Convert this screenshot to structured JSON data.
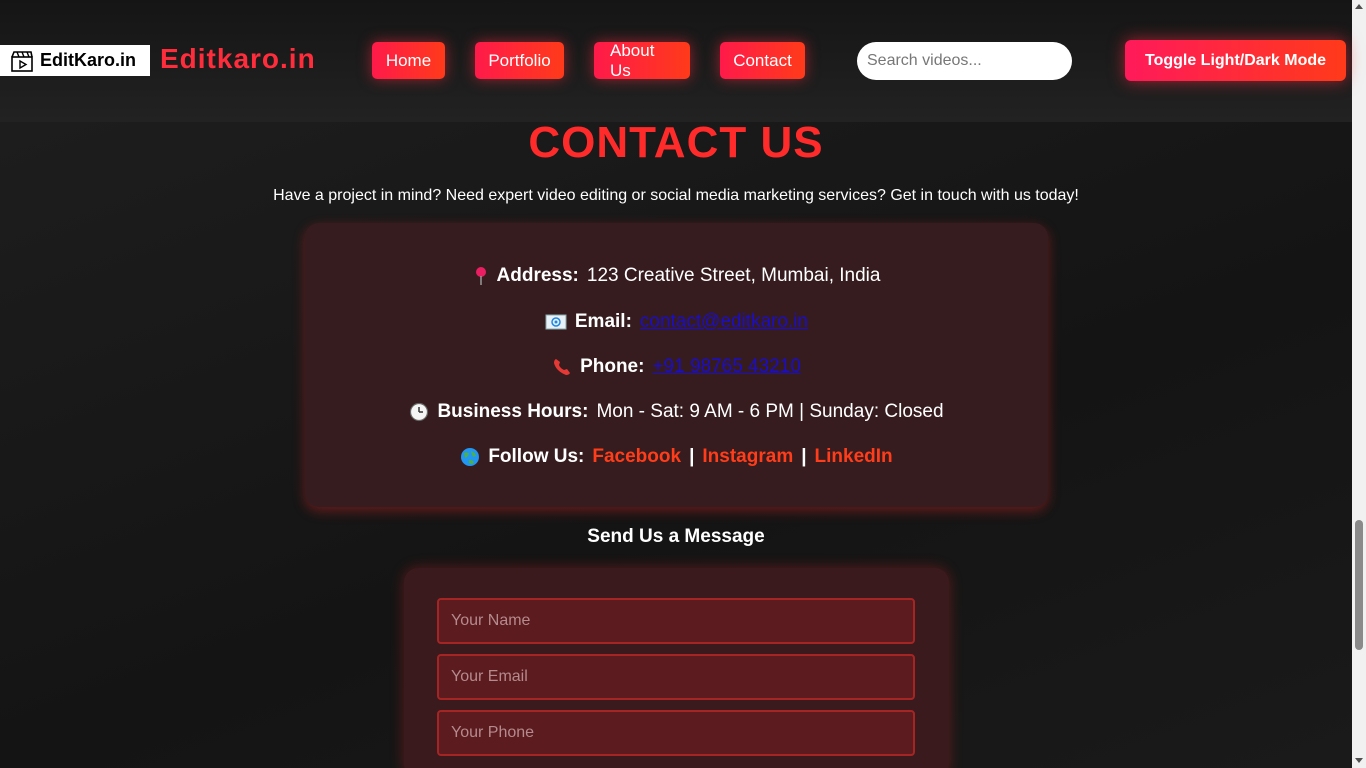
{
  "header": {
    "logo_text": "EditKaro.in",
    "brand": "Editkaro.in",
    "nav": [
      {
        "label": "Home"
      },
      {
        "label": "Portfolio"
      },
      {
        "label": "About Us"
      },
      {
        "label": "Contact"
      }
    ],
    "search_placeholder": "Search videos...",
    "toggle_label": "Toggle Light/Dark Mode"
  },
  "contact": {
    "title": "CONTACT US",
    "subtitle": "Have a project in mind? Need expert video editing or social media marketing services? Get in touch with us today!",
    "address": {
      "icon": "pushpin-icon",
      "label": "Address:",
      "value": "123 Creative Street, Mumbai, India"
    },
    "email": {
      "icon": "email-icon",
      "label": "Email:",
      "value": "contact@editkaro.in"
    },
    "phone": {
      "icon": "phone-icon",
      "label": "Phone:",
      "value": "+91 98765 43210"
    },
    "hours": {
      "icon": "clock-icon",
      "label": "Business Hours:",
      "value": "Mon - Sat: 9 AM - 6 PM | Sunday: Closed"
    },
    "follow": {
      "icon": "globe-icon",
      "label": "Follow Us:",
      "links": [
        "Facebook",
        "Instagram",
        "LinkedIn"
      ],
      "separator": "|"
    }
  },
  "form": {
    "title": "Send Us a Message",
    "name_placeholder": "Your Name",
    "email_placeholder": "Your Email",
    "phone_placeholder": "Your Phone"
  },
  "colors": {
    "accent_red": "#ff2b2b",
    "button_gradient_start": "#ff1a4a",
    "button_gradient_end": "#ff3a1a",
    "link_blue": "#1a0dcc",
    "social_orange": "#ff3d1a"
  }
}
